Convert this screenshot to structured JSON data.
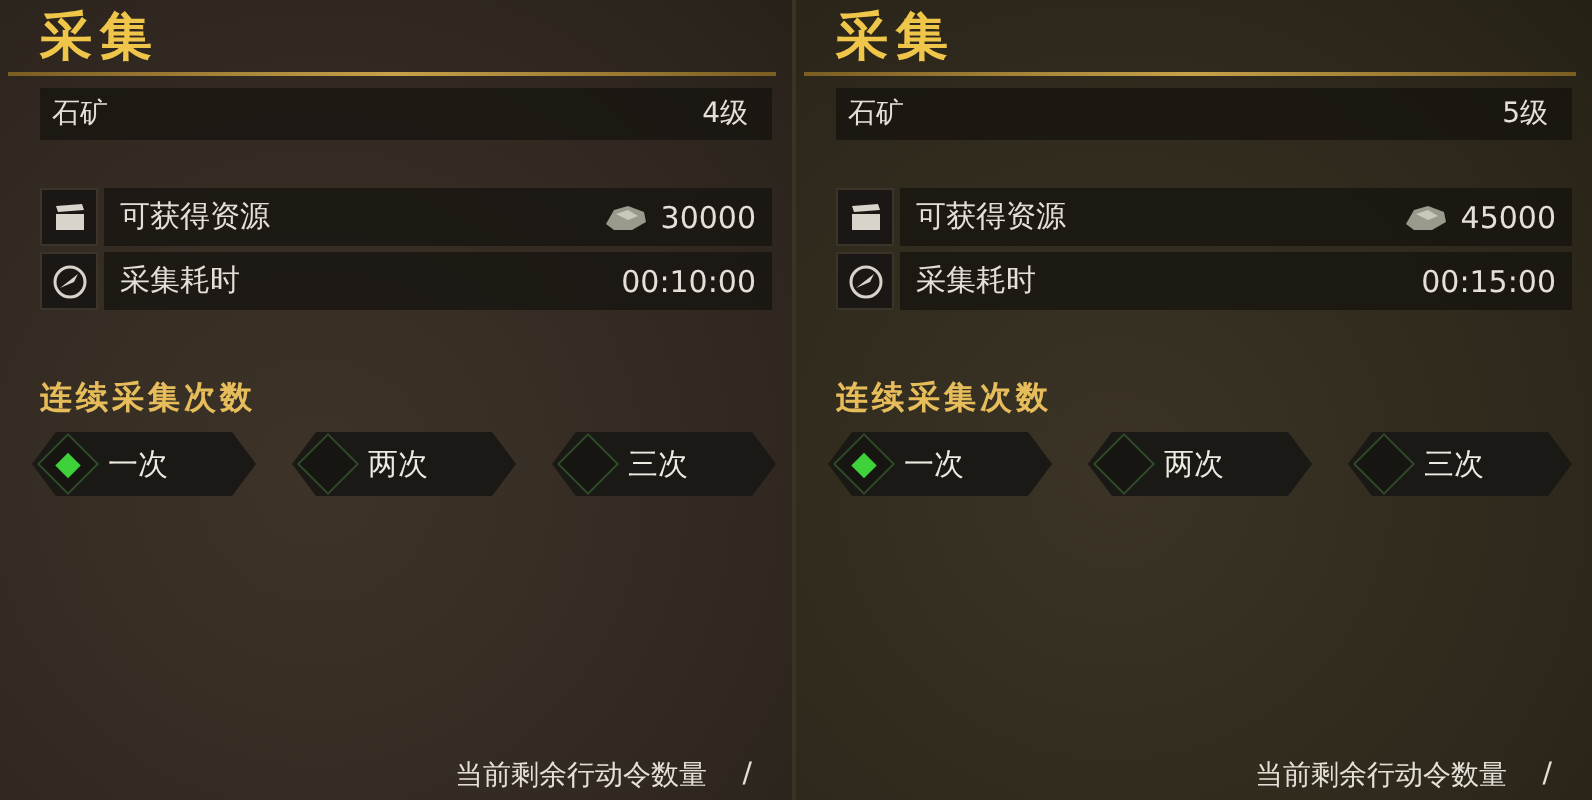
{
  "panels": [
    {
      "title": "采集",
      "target": {
        "name": "石矿",
        "grade": "4级"
      },
      "stats": [
        {
          "kind": "resource",
          "label": "可获得资源",
          "value": "30000"
        },
        {
          "kind": "time",
          "label": "采集耗时",
          "value": "00:10:00"
        }
      ],
      "repeat_label": "连续采集次数",
      "options": [
        {
          "label": "一次",
          "selected": true
        },
        {
          "label": "两次",
          "selected": false
        },
        {
          "label": "三次",
          "selected": false
        }
      ],
      "footer": "当前剩余行动令数量",
      "footer_mark": "/"
    },
    {
      "title": "采集",
      "target": {
        "name": "石矿",
        "grade": "5级"
      },
      "stats": [
        {
          "kind": "resource",
          "label": "可获得资源",
          "value": "45000"
        },
        {
          "kind": "time",
          "label": "采集耗时",
          "value": "00:15:00"
        }
      ],
      "repeat_label": "连续采集次数",
      "options": [
        {
          "label": "一次",
          "selected": true
        },
        {
          "label": "两次",
          "selected": false
        },
        {
          "label": "三次",
          "selected": false
        }
      ],
      "footer": "当前剩余行动令数量",
      "footer_mark": "/"
    }
  ]
}
